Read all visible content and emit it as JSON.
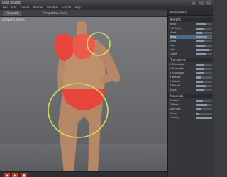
{
  "window": {
    "title": "Daz Studio"
  },
  "menu": [
    "File",
    "Edit",
    "Create",
    "Render",
    "Window",
    "Scripts",
    "Help"
  ],
  "viewport": {
    "tab_label": "Viewport",
    "title": "Perspective View",
    "camera_label": "Default Camera",
    "controls": [
      "◀",
      "▶",
      "■"
    ]
  },
  "side_panel": {
    "header": "Parameters",
    "groups": [
      {
        "title": "Morphs",
        "rows": [
          {
            "label": "Actor",
            "value": 0.6
          },
          {
            "label": "Full Body",
            "value": 0.45
          },
          {
            "label": "Head",
            "value": 0.35
          },
          {
            "label": "Torso",
            "value": 0.7,
            "selected": true
          },
          {
            "label": "Arms",
            "value": 0.5
          },
          {
            "label": "Legs",
            "value": 0.55
          },
          {
            "label": "Hips",
            "value": 0.8
          },
          {
            "label": "Chest",
            "value": 0.65
          }
        ]
      },
      {
        "title": "Transforms",
        "rows": [
          {
            "label": "X Translate",
            "value": 0.5
          },
          {
            "label": "Y Translate",
            "value": 0.5
          },
          {
            "label": "Z Translate",
            "value": 0.5
          },
          {
            "label": "X Rotate",
            "value": 0.3
          },
          {
            "label": "Y Rotate",
            "value": 0.4
          },
          {
            "label": "Z Rotate",
            "value": 0.6
          },
          {
            "label": "Scale",
            "value": 0.5
          }
        ]
      },
      {
        "title": "Materials",
        "rows": [
          {
            "label": "Surface",
            "value": 0.4
          },
          {
            "label": "Diffuse",
            "value": 0.7
          },
          {
            "label": "Specular",
            "value": 0.3
          },
          {
            "label": "Bump",
            "value": 0.2
          },
          {
            "label": "Opacity",
            "value": 1.0
          }
        ]
      }
    ]
  },
  "colors": {
    "bikini": "#e8453a",
    "skin": "#b88a6a",
    "highlight_ring": "#d6e050"
  }
}
